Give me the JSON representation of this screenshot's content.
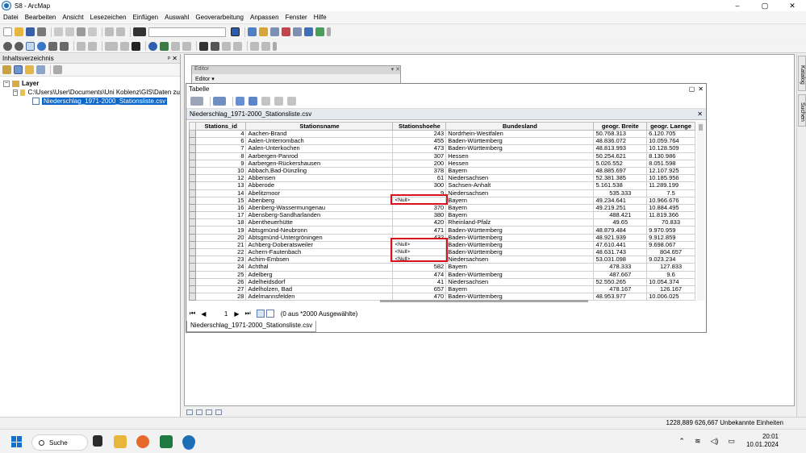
{
  "window": {
    "title": "S8 - ArcMap",
    "controls": [
      "–",
      "▢",
      "✕"
    ]
  },
  "menu": [
    "Datei",
    "Bearbeiten",
    "Ansicht",
    "Lesezeichen",
    "Einfügen",
    "Auswahl",
    "Geoverarbeitung",
    "Anpassen",
    "Fenster",
    "Hilfe"
  ],
  "toc": {
    "title": "Inhaltsverzeichnis",
    "pin": "ᵖ ✕",
    "layer": "Layer",
    "folder": "C:\\Users\\User\\Documents\\Uni Koblenz\\GIS\\Daten zu",
    "table_item": "Niederschlag_1971-2000_Stationsliste.csv"
  },
  "side_tabs": [
    "Katalog",
    "Suchen"
  ],
  "editor": {
    "title": "Editor",
    "label": "Editor ▾"
  },
  "tabelle": {
    "title": "Tabelle",
    "subtitle": "Niederschlag_1971-2000_Stationsliste.csv",
    "columns": [
      "Stations_id",
      "Stationsname",
      "Stationshoehe",
      "Bundesland",
      "geogr. Breite",
      "geogr. Laenge"
    ],
    "rows": [
      [
        "4",
        "Aachen-Brand",
        "243",
        "Nordrhein-Westfalen",
        "50.768.313",
        "6.120.705"
      ],
      [
        "6",
        "Aalen-Unterrombach",
        "455",
        "Baden-Württemberg",
        "48.836.072",
        "10.059.764"
      ],
      [
        "7",
        "Aalen-Unterkochen",
        "473",
        "Baden-Württemberg",
        "48.813.993",
        "10.128.509"
      ],
      [
        "8",
        "Aarbergen-Panrod",
        "307",
        "Hessen",
        "50.254.621",
        "8.130.986"
      ],
      [
        "9",
        "Aarbergen-Rückershausen",
        "200",
        "Hessen",
        "5.026.552",
        "8.051.598"
      ],
      [
        "10",
        "Abbach,Bad-Dünzling",
        "378",
        "Bayern",
        "48.885.697",
        "12.107.925"
      ],
      [
        "12",
        "Abbensen",
        "61",
        "Niedersachsen",
        "52.381.385",
        "10.185.956"
      ],
      [
        "13",
        "Abberode",
        "300",
        "Sachsen-Anhalt",
        "5.161.538",
        "11.289.199"
      ],
      [
        "14",
        "Abelitzmoor",
        "9",
        "Niedersachsen",
        "535.333",
        "7.5"
      ],
      [
        "15",
        "Abenberg",
        "<Null>",
        "Bayern",
        "49.234.641",
        "10.966.676"
      ],
      [
        "16",
        "Abenberg-Wassermungenau",
        "370",
        "Bayern",
        "49.219.251",
        "10.884.495"
      ],
      [
        "17",
        "Abensberg-Sandharlanden",
        "380",
        "Bayern",
        "488.421",
        "11.819.366"
      ],
      [
        "18",
        "Abentheuerhütte",
        "420",
        "Rheinland-Pfalz",
        "49.65",
        "70.833"
      ],
      [
        "19",
        "Abtsgmünd-Neubronn",
        "471",
        "Baden-Württemberg",
        "48.879.484",
        "9.970.959"
      ],
      [
        "20",
        "Abtsgmünd-Untergröningen",
        "432",
        "Baden-Württemberg",
        "48.921.939",
        "9.912.859"
      ],
      [
        "21",
        "Achberg-Doberatsweiler",
        "<Null>",
        "Baden-Württemberg",
        "47.610.441",
        "9.698.067"
      ],
      [
        "22",
        "Achern-Fautenbach",
        "<Null>",
        "Baden-Württemberg",
        "48.631.743",
        "804.657"
      ],
      [
        "23",
        "Achim-Embsen",
        "<Null>",
        "Niedersachsen",
        "53.031.098",
        "9.023.234"
      ],
      [
        "24",
        "Achthal",
        "582",
        "Bayern",
        "478.333",
        "127.833"
      ],
      [
        "25",
        "Adelberg",
        "474",
        "Baden-Württemberg",
        "487.667",
        "9.6"
      ],
      [
        "26",
        "Adelheidsdorf",
        "41",
        "Niedersachsen",
        "52.550.265",
        "10.054.374"
      ],
      [
        "27",
        "Adelholzen, Bad",
        "657",
        "Bayern",
        "478.167",
        "126.167"
      ],
      [
        "28",
        "Adelmannsfelden",
        "470",
        "Baden-Württemberg",
        "48.953.977",
        "10.006.025"
      ]
    ],
    "nav": {
      "first": "⏮",
      "prev": "◀",
      "page": "1",
      "next": "▶",
      "last": "⏭",
      "selection": "(0 aus *2000 Ausgewählte)"
    },
    "tab_label": "Niederschlag_1971-2000_Stationsliste.csv"
  },
  "status": {
    "coords": "1228,889  626,667 Unbekannte Einheiten"
  },
  "taskbar": {
    "search": "Suche",
    "time": "20:01",
    "date": "10.01.2024"
  },
  "colors": {
    "highlight": "#d9111c",
    "selection_blue": "#0a66c8"
  }
}
